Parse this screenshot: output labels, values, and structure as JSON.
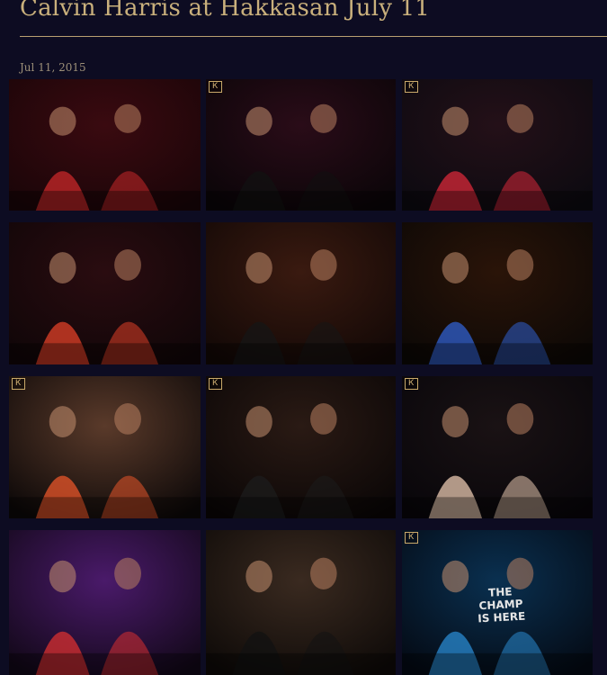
{
  "post": {
    "title": "Calvin Harris at Hakkasan July 11",
    "date": "Jul 11, 2015"
  },
  "gallery": {
    "photos": [
      {
        "alt": "photo 1",
        "logo": "",
        "bg": [
          "#3a0a10",
          "#1a0508"
        ],
        "accent": "#c8282a"
      },
      {
        "alt": "photo 2",
        "logo": "Ꮶ",
        "bg": [
          "#2a0c18",
          "#0a0508"
        ],
        "accent": "#111111"
      },
      {
        "alt": "photo 3",
        "logo": "Ꮶ",
        "bg": [
          "#241018",
          "#0c0a10"
        ],
        "accent": "#d8283a"
      },
      {
        "alt": "photo 4",
        "logo": "",
        "bg": [
          "#2a0c10",
          "#100608"
        ],
        "accent": "#e04028"
      },
      {
        "alt": "photo 5",
        "logo": "",
        "bg": [
          "#3a1a10",
          "#120806"
        ],
        "accent": "#161616"
      },
      {
        "alt": "photo 6",
        "logo": "",
        "bg": [
          "#2a1408",
          "#0c0806"
        ],
        "accent": "#3060d0"
      },
      {
        "alt": "photo 7",
        "logo": "Ꮶ",
        "bg": [
          "#5a3a2a",
          "#0c0808"
        ],
        "accent": "#e8562a"
      },
      {
        "alt": "photo 8",
        "logo": "Ꮶ",
        "bg": [
          "#2a1a14",
          "#0a0606"
        ],
        "accent": "#1c1c1c"
      },
      {
        "alt": "photo 9",
        "logo": "Ꮶ",
        "bg": [
          "#1a1214",
          "#08060a"
        ],
        "accent": "#e8c8b0"
      },
      {
        "alt": "photo 10",
        "logo": "",
        "bg": [
          "#4a1a6a",
          "#120818"
        ],
        "accent": "#d83030"
      },
      {
        "alt": "photo 11",
        "logo": "",
        "bg": [
          "#3a2a20",
          "#0e0a08"
        ],
        "accent": "#121212"
      },
      {
        "alt": "photo 12",
        "logo": "Ꮶ",
        "bg": [
          "#0a3050",
          "#040a14"
        ],
        "accent": "#2a8ad0",
        "banner": "THE CHAMP IS HERE"
      }
    ]
  },
  "colors": {
    "background": "#0d0c22",
    "title": "#c9b07c",
    "rule": "#b8a071",
    "date": "#9c8f78",
    "logo": "#d9b878"
  }
}
